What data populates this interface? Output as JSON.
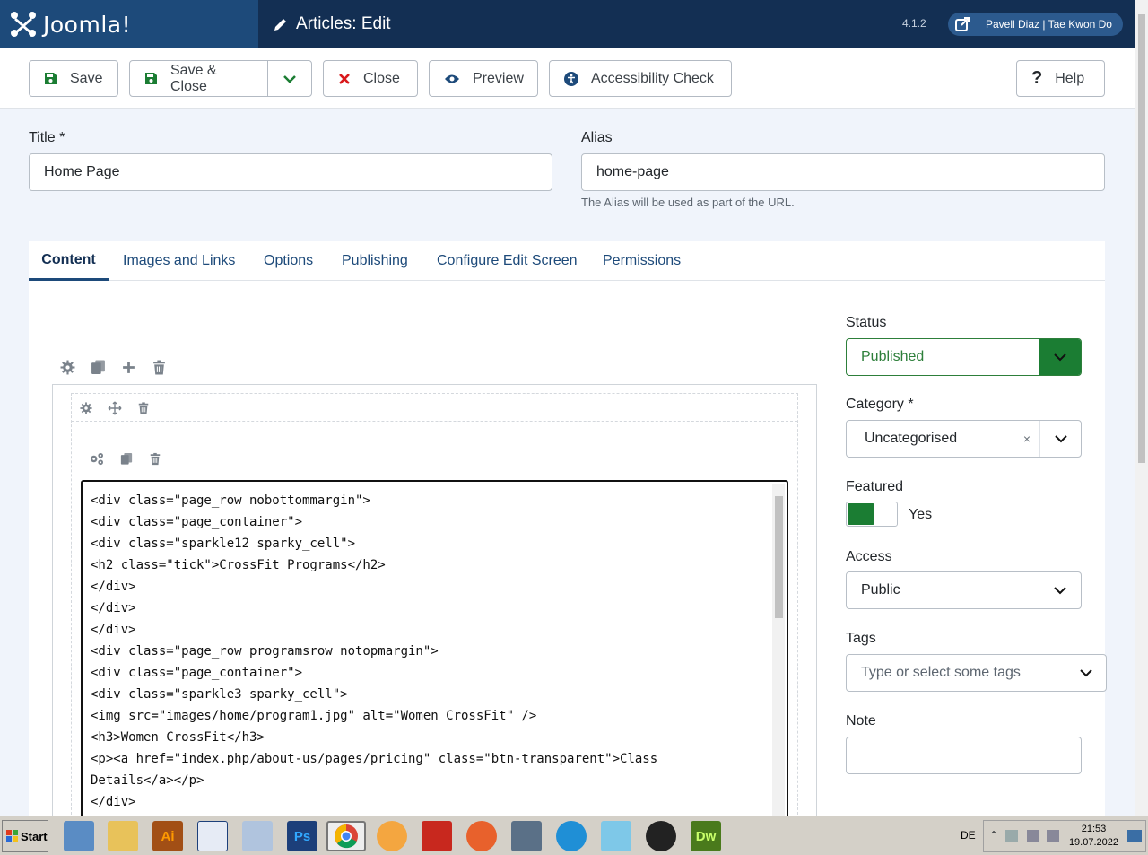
{
  "header": {
    "logo_text": "Joomla!",
    "page_title": "Articles: Edit",
    "version": "4.1.2",
    "user": "Pavell Diaz | Tae Kwon Do"
  },
  "toolbar": {
    "save": "Save",
    "save_close": "Save & Close",
    "close": "Close",
    "preview": "Preview",
    "accessibility": "Accessibility Check",
    "help": "Help"
  },
  "form": {
    "title_label": "Title *",
    "title_value": "Home Page",
    "alias_label": "Alias",
    "alias_value": "home-page",
    "alias_hint": "The Alias will be used as part of the URL."
  },
  "tabs": [
    {
      "label": "Content"
    },
    {
      "label": "Images and Links"
    },
    {
      "label": "Options"
    },
    {
      "label": "Publishing"
    },
    {
      "label": "Configure Edit Screen"
    },
    {
      "label": "Permissions"
    }
  ],
  "editor": {
    "code": "<div class=\"page_row nobottommargin\">\n<div class=\"page_container\">\n<div class=\"sparkle12 sparky_cell\">\n<h2 class=\"tick\">CrossFit Programs</h2>\n</div>\n</div>\n</div>\n<div class=\"page_row programsrow notopmargin\">\n<div class=\"page_container\">\n<div class=\"sparkle3 sparky_cell\">\n<img src=\"images/home/program1.jpg\" alt=\"Women CrossFit\" />\n<h3>Women CrossFit</h3>\n<p><a href=\"index.php/about-us/pages/pricing\" class=\"btn-transparent\">Class\nDetails</a></p>\n</div>"
  },
  "sidebar": {
    "status_label": "Status",
    "status_value": "Published",
    "category_label": "Category *",
    "category_value": "Uncategorised",
    "category_clear": "×",
    "featured_label": "Featured",
    "featured_value": "Yes",
    "access_label": "Access",
    "access_value": "Public",
    "tags_label": "Tags",
    "tags_placeholder": "Type or select some tags",
    "note_label": "Note",
    "note_value": ""
  },
  "taskbar": {
    "start": "Start",
    "apps": [
      {
        "name": "Ai",
        "color": "#a24f15"
      },
      {
        "name": "Ps",
        "color": "#1c3f7a"
      },
      {
        "name": "Dw",
        "color": "#4a7a1c"
      }
    ],
    "lang": "DE",
    "time": "21:53",
    "date": "19.07.2022"
  },
  "colors": {
    "header_bg": "#132f53",
    "logo_bg": "#1d4a7a",
    "accent_green": "#1b7d33",
    "close_red": "#d9191c"
  }
}
